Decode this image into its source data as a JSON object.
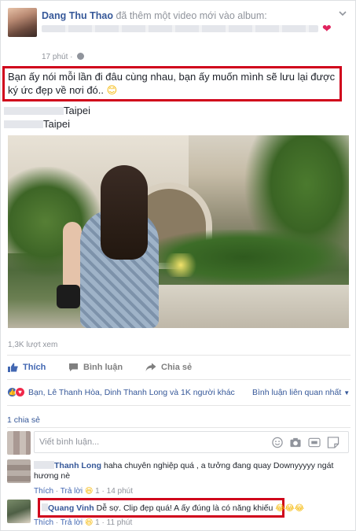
{
  "post": {
    "author": "Dang Thu Thao",
    "action": "đã thêm một video mới vào album:",
    "time": "17 phút",
    "dot": "·",
    "caption": "Bạn ấy nói mỗi lần đi đâu cùng nhau, bạn ấy muốn mình sẽ lưu lại được ký ức đẹp về nơi đó..",
    "caption_emoji": "😊",
    "location_1": "Taipei",
    "location_2": "Taipei",
    "views": "1,3K lượt xem"
  },
  "actions": {
    "like": "Thích",
    "comment": "Bình luận",
    "share": "Chia sẻ"
  },
  "reactions": {
    "summary": "Bạn, Lê Thanh Hòa, Dinh Thanh Long và 1K người khác",
    "related": "Bình luận liên quan nhất",
    "caret": "▼",
    "shares": "1 chia sẻ"
  },
  "composer": {
    "placeholder": "Viết bình luận..."
  },
  "comments": [
    {
      "name": "Thanh Long",
      "text": "haha chuyên nghiệp quá , a tưởng đang quay Downyyyyy ngát hương nè",
      "like": "Thích",
      "reply": "Trả lời",
      "emoji": "😆",
      "count": "1",
      "time": "14 phút",
      "sep": "·"
    },
    {
      "name": "Quang Vinh",
      "text": "Dễ sợ. Clip đẹp quá! A ấy đúng là có năng khiếu",
      "emojis": "😂😂😂",
      "like": "Thích",
      "reply": "Trả lời",
      "emoji": "😆",
      "count": "1",
      "time": "11 phút",
      "sep": "·"
    }
  ],
  "colors": {
    "link": "#365899",
    "highlight_border": "#d0021b",
    "like_blue": "#4267b2",
    "heart": "#e0245e"
  }
}
